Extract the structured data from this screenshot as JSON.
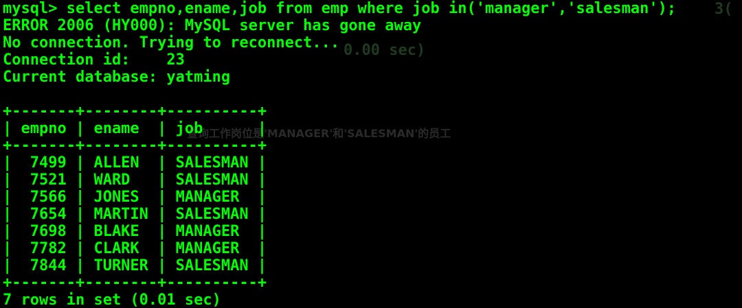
{
  "theme": {
    "background": "#000000",
    "foreground": "#00ff00"
  },
  "ghost": {
    "row_count_fragment": "0.00 sec)",
    "table_corner_fragment": "3(",
    "caption": "查询工作岗位是'MANAGER'和'SALESMAN'的员工"
  },
  "terminal": {
    "lines": [
      "mysql> select empno,ename,job from emp where job in('manager','salesman');",
      "ERROR 2006 (HY000): MySQL server has gone away",
      "No connection. Trying to reconnect...",
      "Connection id:    23",
      "Current database: yatming",
      "",
      "+-------+--------+----------+",
      "| empno | ename  | job      |",
      "+-------+--------+----------+",
      "|  7499 | ALLEN  | SALESMAN |",
      "|  7521 | WARD   | SALESMAN |",
      "|  7566 | JONES  | MANAGER  |",
      "|  7654 | MARTIN | SALESMAN |",
      "|  7698 | BLAKE  | MANAGER  |",
      "|  7782 | CLARK  | MANAGER  |",
      "|  7844 | TURNER | SALESMAN |",
      "+-------+--------+----------+",
      "7 rows in set (0.01 sec)"
    ]
  }
}
